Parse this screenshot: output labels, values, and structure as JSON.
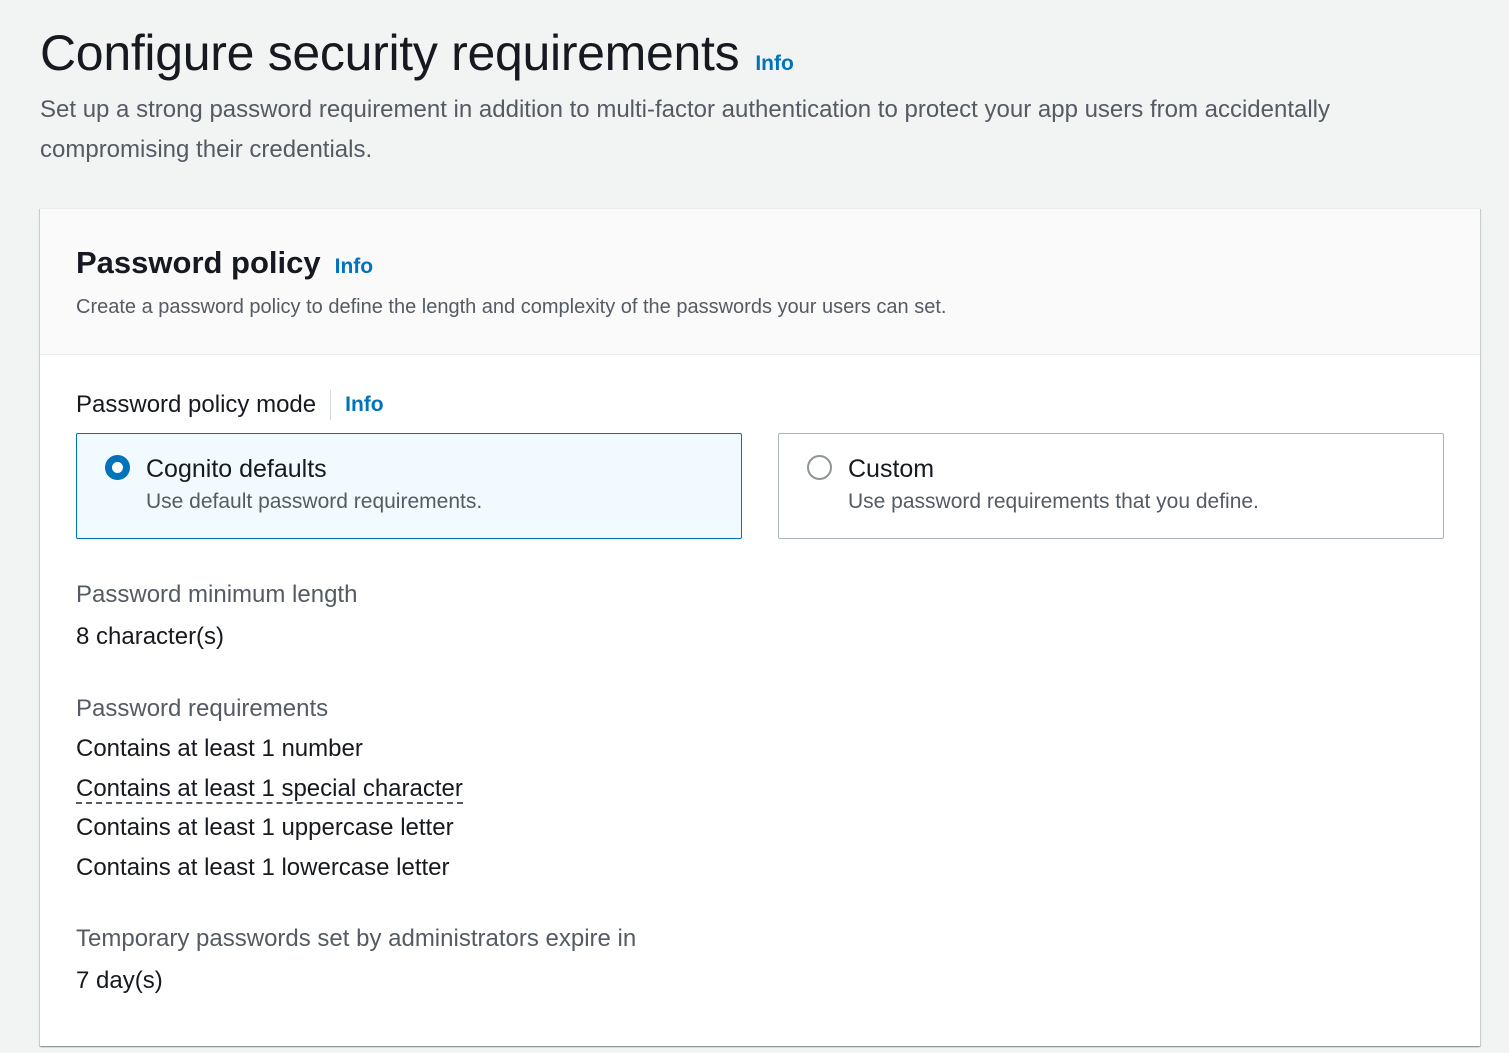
{
  "header": {
    "title": "Configure security requirements",
    "info_label": "Info",
    "description": "Set up a strong password requirement in addition to multi-factor authentication to protect your app users from accidentally compromising their credentials."
  },
  "password_policy": {
    "title": "Password policy",
    "info_label": "Info",
    "description": "Create a password policy to define the length and complexity of the passwords your users can set.",
    "mode": {
      "label": "Password policy mode",
      "info_label": "Info",
      "selected": "cognito-defaults",
      "options": [
        {
          "id": "cognito-defaults",
          "title": "Cognito defaults",
          "description": "Use default password requirements."
        },
        {
          "id": "custom",
          "title": "Custom",
          "description": "Use password requirements that you define."
        }
      ]
    },
    "min_length": {
      "label": "Password minimum length",
      "value": "8 character(s)"
    },
    "requirements": {
      "label": "Password requirements",
      "items": [
        "Contains at least 1 number",
        "Contains at least 1 special character",
        "Contains at least 1 uppercase letter",
        "Contains at least 1 lowercase letter"
      ]
    },
    "temp_password": {
      "label": "Temporary passwords set by administrators expire in",
      "value": "7 day(s)"
    }
  },
  "colors": {
    "link": "#0073bb",
    "selected_tile_bg": "#f1faff",
    "page_bg": "#f2f3f3"
  }
}
